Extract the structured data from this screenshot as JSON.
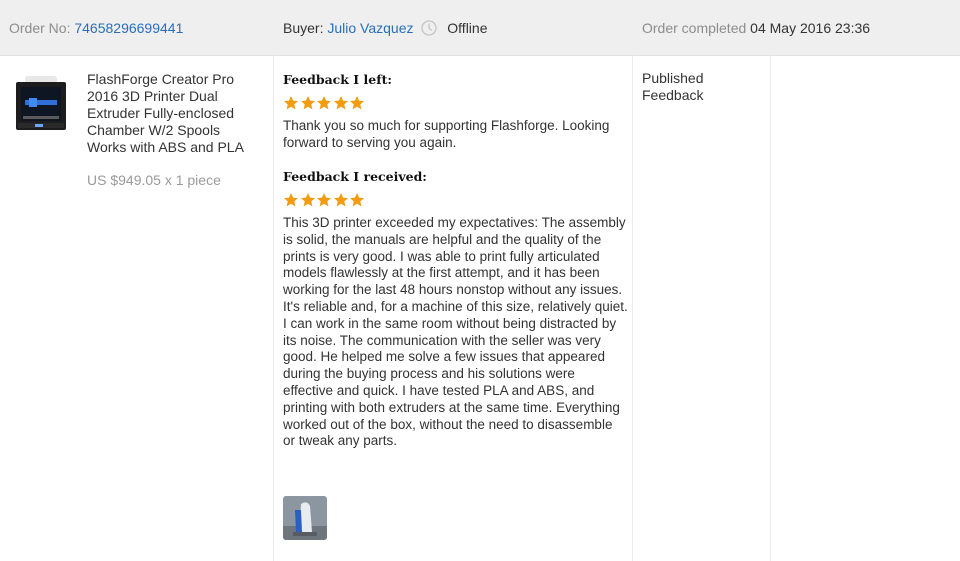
{
  "header": {
    "order_label": "Order No:",
    "order_number": "74658296699441",
    "buyer_label": "Buyer:",
    "buyer_name": "Julio Vazquez",
    "buyer_status": "Offline",
    "completed_label": "Order completed",
    "completed_date": "04 May 2016 23:36"
  },
  "product": {
    "image_icon": "3d-printer-thumbnail",
    "title": "FlashForge Creator Pro 2016 3D Printer Dual Extruder Fully-enclosed Chamber W/2 Spools Works with ABS and PLA",
    "price": "US $949.05 x 1 piece"
  },
  "feedback_left": {
    "label": "Feedback I left:",
    "stars": 5,
    "text": "Thank you so much for supporting Flashforge. Looking forward to serving you again."
  },
  "feedback_received": {
    "label": "Feedback I received:",
    "stars": 5,
    "text": "This 3D printer exceeded my expectatives: The assembly is solid, the manuals are helpful and the quality of the prints is very good. I was able to print fully articulated models flawlessly at the first attempt, and it has been working for the last 48 hours nonstop without any issues. It's reliable and, for a machine of this size, relatively quiet. I can work in the same room without being distracted by its noise. The communication with the seller was very good. He helped me solve a few issues that appeared during the buying process and his solutions were effective and quick. I have tested PLA and ABS, and printing with both extruders at the same time. Everything worked out of the box, without the need to disassemble or tweak any parts.",
    "photo_icon": "review-photo-thumbnail"
  },
  "status": {
    "text": "Published Feedback"
  },
  "colors": {
    "header_bg": "#efefef",
    "link": "#2a6ebb",
    "star": "#f39c12",
    "muted_text": "#8d8d8d"
  }
}
